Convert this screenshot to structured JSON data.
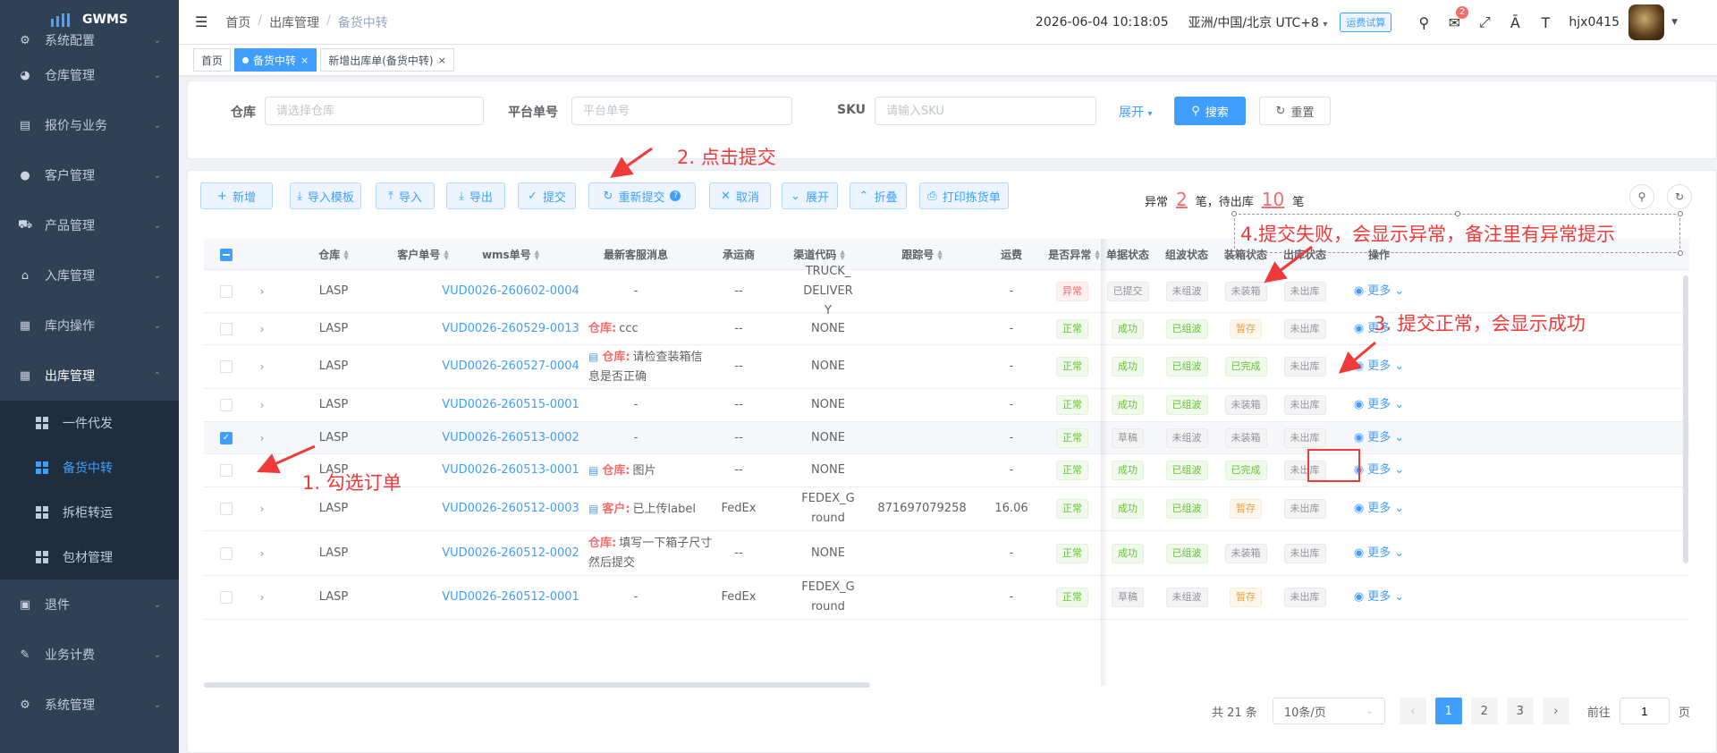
{
  "sidebar": {
    "logo": "GWMS",
    "items": [
      {
        "label": "系统配置",
        "icon": "gear-icon",
        "glyph": "⚙"
      },
      {
        "label": "仓库管理",
        "icon": "globe-icon",
        "glyph": "◕"
      },
      {
        "label": "报价与业务",
        "icon": "document-icon",
        "glyph": "▤"
      },
      {
        "label": "客户管理",
        "icon": "user-icon",
        "glyph": "●"
      },
      {
        "label": "产品管理",
        "icon": "cart-icon",
        "glyph": "⛟"
      },
      {
        "label": "入库管理",
        "icon": "home-icon",
        "glyph": "⌂"
      },
      {
        "label": "库内操作",
        "icon": "grid-icon",
        "glyph": "▦"
      },
      {
        "label": "出库管理",
        "icon": "apps-icon",
        "glyph": "▦"
      }
    ],
    "submenu": [
      "一件代发",
      "备货中转",
      "拆柜转运",
      "包材管理"
    ],
    "bottom_items": [
      {
        "label": "退件",
        "icon": "return-icon",
        "glyph": "▣"
      },
      {
        "label": "业务计费",
        "icon": "edit-icon",
        "glyph": "✎"
      },
      {
        "label": "系统管理",
        "icon": "settings-icon",
        "glyph": "⚙"
      }
    ]
  },
  "header": {
    "breadcrumb": [
      "首页",
      "出库管理",
      "备货中转"
    ],
    "datetime": "2026-06-04 10:18:05",
    "timezone": "亚洲/中国/北京 UTC+8",
    "freight_calc": "运费试算",
    "notify_count": "2",
    "username": "hjx0415"
  },
  "tags": [
    "首页",
    "备货中转",
    "新增出库单(备货中转)"
  ],
  "search": {
    "warehouse_label": "仓库",
    "warehouse_placeholder": "请选择仓库",
    "platform_label": "平台单号",
    "platform_placeholder": "平台单号",
    "sku_label": "SKU",
    "sku_placeholder": "请输入SKU",
    "expand": "展开",
    "search_btn": "搜索",
    "reset_btn": "重置"
  },
  "toolbar": {
    "add": "新增",
    "import_template": "导入模板",
    "import": "导入",
    "export": "导出",
    "submit": "提交",
    "resubmit": "重新提交",
    "cancel": "取消",
    "expand": "展开",
    "collapse": "折叠",
    "print": "打印拣货单",
    "abnormal_label": "异常",
    "abnormal_count": "2",
    "pending_label": "笔，待出库",
    "pending_count": "10",
    "unit": "笔"
  },
  "table": {
    "columns": [
      "仓库",
      "客户单号",
      "wms单号",
      "最新客服消息",
      "承运商",
      "渠道代码",
      "跟踪号",
      "运费",
      "是否异常",
      "单据状态",
      "组波状态",
      "装箱状态",
      "出库状态",
      "操作"
    ],
    "more_label": "更多",
    "rows": [
      {
        "checked": false,
        "warehouse": "LASP",
        "wms": "VUD0026-260602-0004",
        "msg_tag": "",
        "msg": "-",
        "msg_icon": false,
        "carrier": "--",
        "channel": "TRUCK_DELIVERY",
        "tracking": "",
        "fee": "-",
        "abnormal": "异常",
        "doc": "已提交",
        "wave": "未组波",
        "pack": "未装箱",
        "out": "未出库"
      },
      {
        "checked": false,
        "warehouse": "LASP",
        "wms": "VUD0026-260529-0013",
        "msg_tag": "仓库:",
        "msg": "ccc",
        "msg_icon": false,
        "carrier": "--",
        "channel": "NONE",
        "tracking": "",
        "fee": "-",
        "abnormal": "正常",
        "doc": "成功",
        "wave": "已组波",
        "pack": "暂存",
        "out": "未出库"
      },
      {
        "checked": false,
        "warehouse": "LASP",
        "wms": "VUD0026-260527-0004",
        "msg_tag": "仓库:",
        "msg": "请检查装箱信息是否正确",
        "msg_icon": true,
        "carrier": "--",
        "channel": "NONE",
        "tracking": "",
        "fee": "-",
        "abnormal": "正常",
        "doc": "成功",
        "wave": "已组波",
        "pack": "已完成",
        "out": "未出库"
      },
      {
        "checked": false,
        "warehouse": "LASP",
        "wms": "VUD0026-260515-0001",
        "msg_tag": "",
        "msg": "-",
        "msg_icon": false,
        "carrier": "--",
        "channel": "NONE",
        "tracking": "",
        "fee": "-",
        "abnormal": "正常",
        "doc": "成功",
        "wave": "已组波",
        "pack": "未装箱",
        "out": "未出库"
      },
      {
        "checked": true,
        "warehouse": "LASP",
        "wms": "VUD0026-260513-0002",
        "msg_tag": "",
        "msg": "-",
        "msg_icon": false,
        "carrier": "--",
        "channel": "NONE",
        "tracking": "",
        "fee": "-",
        "abnormal": "正常",
        "doc": "草稿",
        "wave": "未组波",
        "pack": "未装箱",
        "out": "未出库"
      },
      {
        "checked": false,
        "warehouse": "LASP",
        "wms": "VUD0026-260513-0001",
        "msg_tag": "仓库:",
        "msg": "图片",
        "msg_icon": true,
        "carrier": "--",
        "channel": "NONE",
        "tracking": "",
        "fee": "-",
        "abnormal": "正常",
        "doc": "成功",
        "wave": "已组波",
        "pack": "已完成",
        "out": "未出库"
      },
      {
        "checked": false,
        "warehouse": "LASP",
        "wms": "VUD0026-260512-0003",
        "msg_tag": "客户:",
        "msg": "已上传label",
        "msg_icon": true,
        "carrier": "FedEx",
        "channel": "FEDEX_Ground",
        "tracking": "871697079258",
        "fee": "16.06",
        "abnormal": "正常",
        "doc": "成功",
        "wave": "已组波",
        "pack": "暂存",
        "out": "未出库"
      },
      {
        "checked": false,
        "warehouse": "LASP",
        "wms": "VUD0026-260512-0002",
        "msg_tag": "仓库:",
        "msg": "填写一下箱子尺寸然后提交",
        "msg_icon": false,
        "carrier": "--",
        "channel": "NONE",
        "tracking": "",
        "fee": "-",
        "abnormal": "正常",
        "doc": "成功",
        "wave": "已组波",
        "pack": "未装箱",
        "out": "未出库"
      },
      {
        "checked": false,
        "warehouse": "LASP",
        "wms": "VUD0026-260512-0001",
        "msg_tag": "",
        "msg": "-",
        "msg_icon": false,
        "carrier": "FedEx",
        "channel": "FEDEX_Ground",
        "tracking": "",
        "fee": "-",
        "abnormal": "正常",
        "doc": "草稿",
        "wave": "未组波",
        "pack": "暂存",
        "out": "未出库"
      }
    ]
  },
  "pagination": {
    "total": "共 21 条",
    "page_size": "10条/页",
    "pages": [
      "1",
      "2",
      "3"
    ],
    "current": "1",
    "goto_label": "前往",
    "goto_value": "1",
    "page_unit": "页"
  },
  "annotations": {
    "step1": "1. 勾选订单",
    "step2": "2. 点击提交",
    "step3": "3. 提交正常，会显示成功",
    "step4": "4.提交失败，会显示异常，备注里有异常提示",
    "color": "#f03a3a"
  },
  "colors": {
    "primary": "#409eff",
    "sidebar": "#304156",
    "danger": "#f56c6c",
    "success": "#67c23a",
    "warning": "#e6a23c"
  }
}
